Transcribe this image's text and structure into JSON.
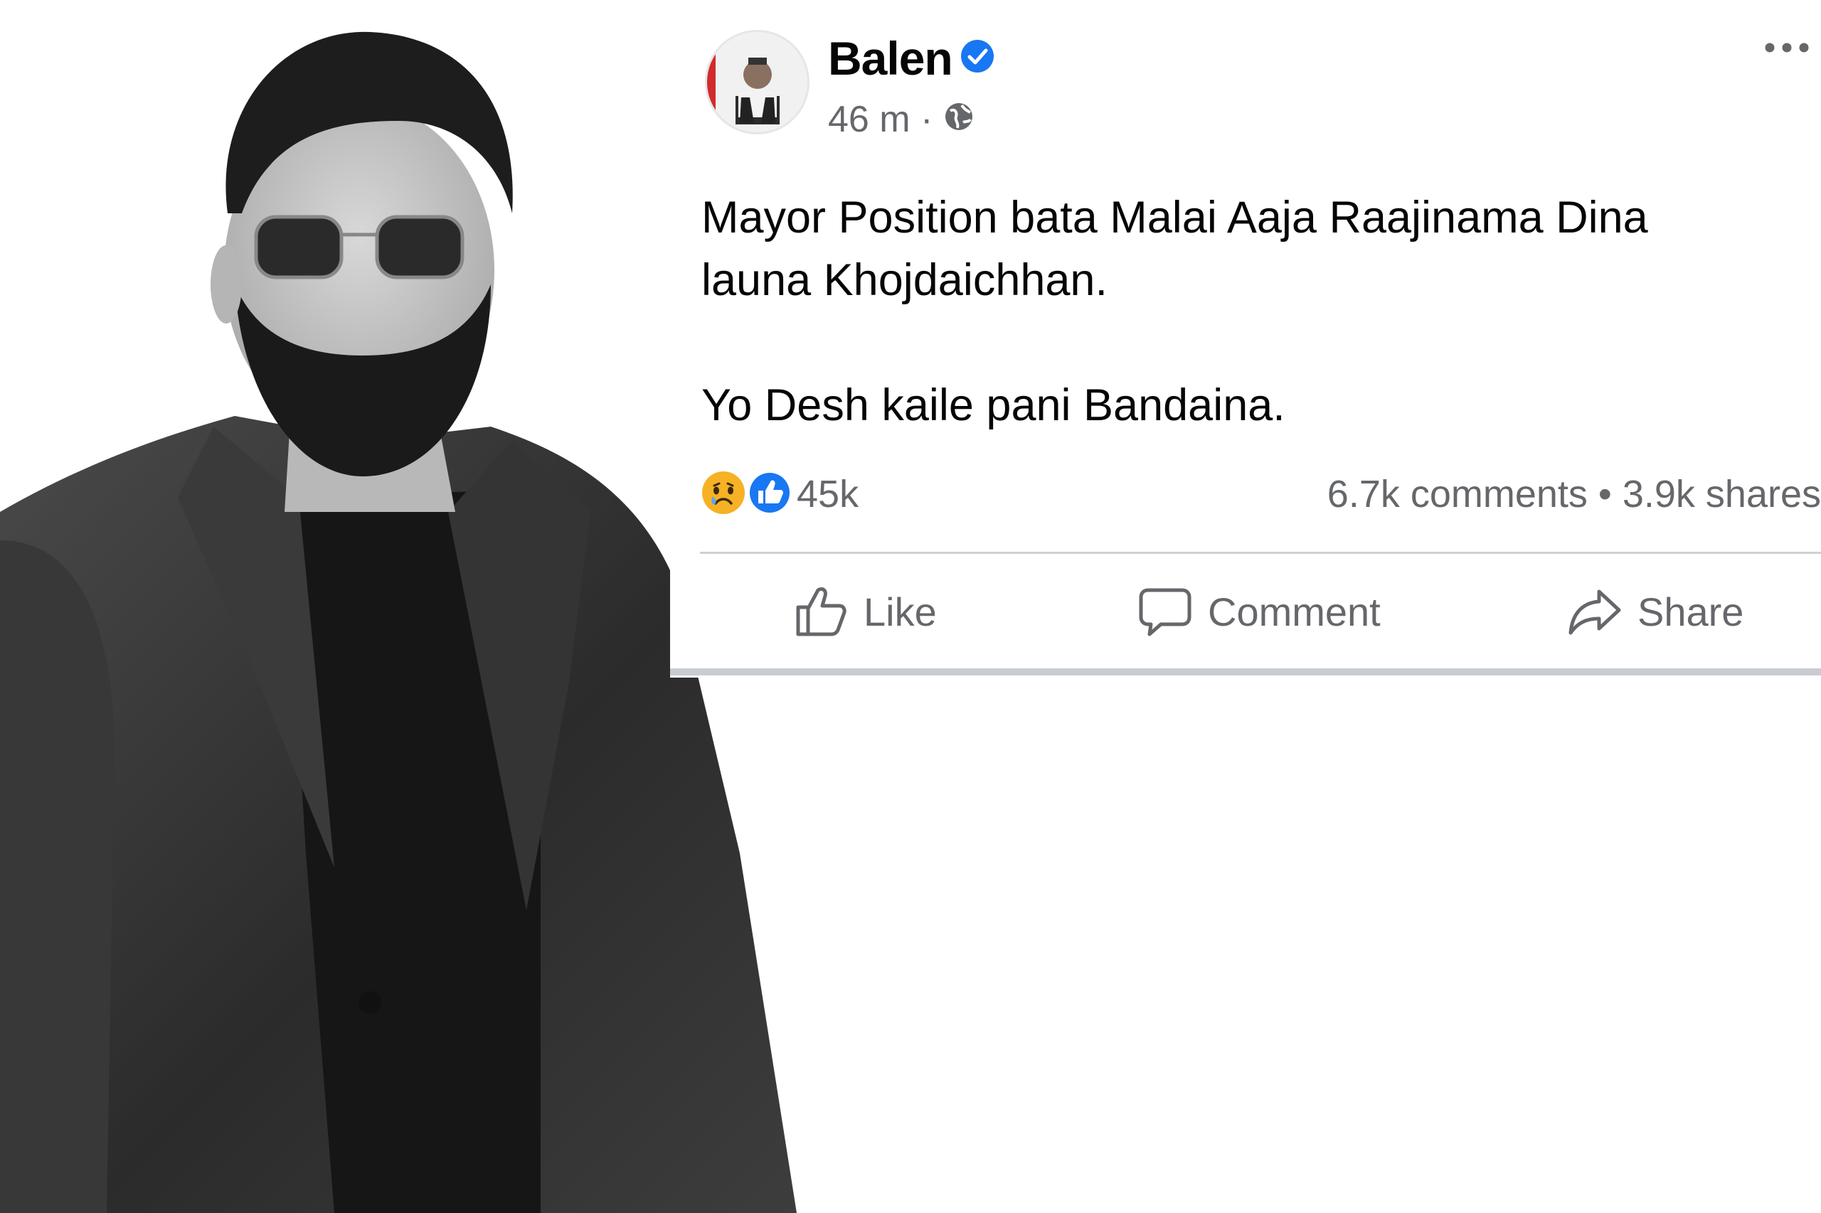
{
  "post": {
    "author": "Balen",
    "time": "46 m",
    "time_separator": "·",
    "text_lines": [
      "Mayor Position bata Malai Aaja Raajinama Dina",
      "launa Khojdaichhan.",
      "Yo Desh kaile pani Bandaina."
    ],
    "reactions": {
      "icons": [
        "sad-reaction-icon",
        "like-reaction-icon"
      ],
      "count": "45k"
    },
    "comments_shares": "6.7k comments • 3.9k shares",
    "actions": {
      "like_label": "Like",
      "comment_label": "Comment",
      "share_label": "Share"
    }
  },
  "colors": {
    "verified_blue": "#1877f2",
    "meta_gray": "#65676b",
    "text_black": "#050505",
    "sad_yellow": "#f7b125",
    "like_blue": "#1877f2"
  }
}
